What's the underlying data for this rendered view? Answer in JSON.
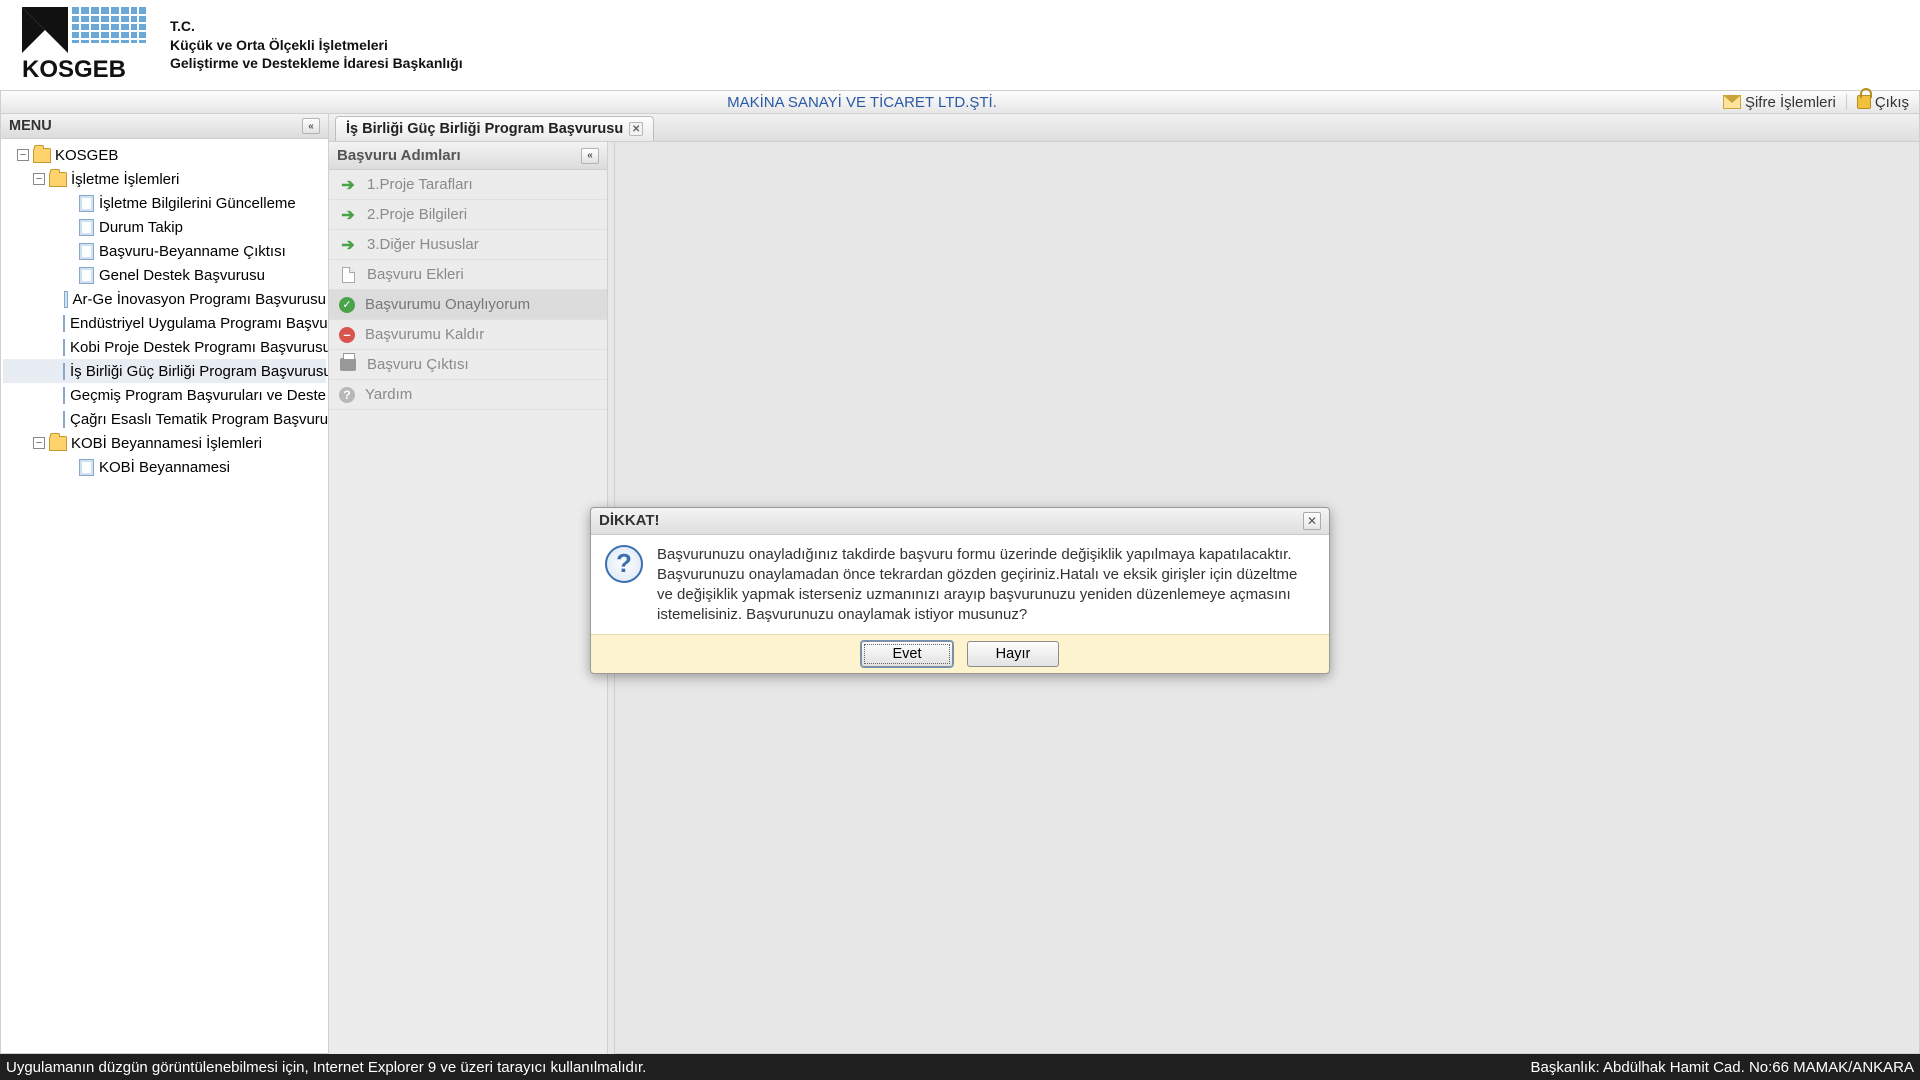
{
  "header": {
    "line1": "T.C.",
    "line2": "Küçük ve Orta Ölçekli İşletmeleri",
    "line3": "Geliştirme ve Destekleme İdaresi Başkanlığı",
    "logo_text": "KOSGEB"
  },
  "topbar": {
    "company": "MAKİNA SANAYİ VE TİCARET LTD.ŞTİ.",
    "password_ops": "Şifre İşlemleri",
    "logout": "Çıkış"
  },
  "sidebar": {
    "title": "MENU",
    "root": "KOSGEB",
    "group1": "İşletme İşlemleri",
    "group1_items": [
      "İşletme Bilgilerini Güncelleme",
      "Durum Takip",
      "Başvuru-Beyanname Çıktısı",
      "Genel Destek Başvurusu",
      "Ar-Ge İnovasyon Programı Başvurusu",
      "Endüstriyel Uygulama Programı Başvu",
      "Kobi Proje Destek Programı Başvurusu",
      "İş Birliği Güç Birliği Program Başvurusu",
      "Geçmiş Program Başvuruları ve Deste",
      "Çağrı Esaslı Tematik Program Başvuru"
    ],
    "group2": "KOBİ Beyannamesi İşlemleri",
    "group2_items": [
      "KOBİ Beyannamesi"
    ]
  },
  "tab": {
    "title": "İş Birliği Güç Birliği Program Başvurusu"
  },
  "steps": {
    "title": "Başvuru Adımları",
    "items": [
      {
        "label": "1.Proje Tarafları",
        "icon": "arrow"
      },
      {
        "label": "2.Proje Bilgileri",
        "icon": "arrow"
      },
      {
        "label": "3.Diğer Hususlar",
        "icon": "arrow"
      },
      {
        "label": "Başvuru Ekleri",
        "icon": "doc"
      },
      {
        "label": "Başvurumu Onaylıyorum",
        "icon": "check",
        "active": true
      },
      {
        "label": "Başvurumu Kaldır",
        "icon": "minus"
      },
      {
        "label": "Başvuru Çıktısı",
        "icon": "print"
      },
      {
        "label": "Yardım",
        "icon": "help"
      }
    ]
  },
  "dialog": {
    "title": "DİKKAT!",
    "message": "Başvurunuzu onayladığınız takdirde başvuru formu üzerinde değişiklik yapılmaya kapatılacaktır. Başvurunuzu onaylamadan önce tekrardan gözden geçiriniz.Hatalı ve eksik girişler için düzeltme ve değişiklik yapmak isterseniz uzmanınızı arayıp başvurunuzu yeniden düzenlemeye açmasını istemelisiniz. Başvurunuzu onaylamak istiyor musunuz?",
    "yes": "Evet",
    "no": "Hayır"
  },
  "status": {
    "left": "Uygulamanın düzgün görüntülenebilmesi için, Internet Explorer 9 ve üzeri tarayıcı kullanılmalıdır.",
    "right": "Başkanlık: Abdülhak Hamit Cad. No:66 MAMAK/ANKARA"
  }
}
